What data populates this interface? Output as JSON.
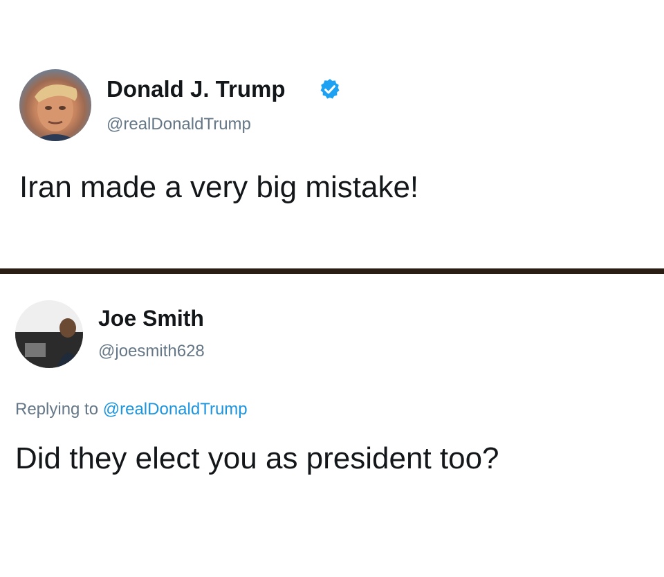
{
  "tweets": [
    {
      "display_name": "Donald J. Trump",
      "handle": "@realDonaldTrump",
      "verified": true,
      "text": "Iran made a very big mistake!"
    },
    {
      "display_name": "Joe Smith",
      "handle": "@joesmith628",
      "reply_prefix": "Replying to",
      "reply_to": "@realDonaldTrump",
      "text": "Did they elect you as president too?"
    }
  ],
  "colors": {
    "handle_gray": "#657786",
    "link_blue": "#1b95e0",
    "verified_blue": "#1da1f2",
    "divider": "#2a1d14"
  },
  "icons": {
    "verified": "verified-badge-icon"
  }
}
